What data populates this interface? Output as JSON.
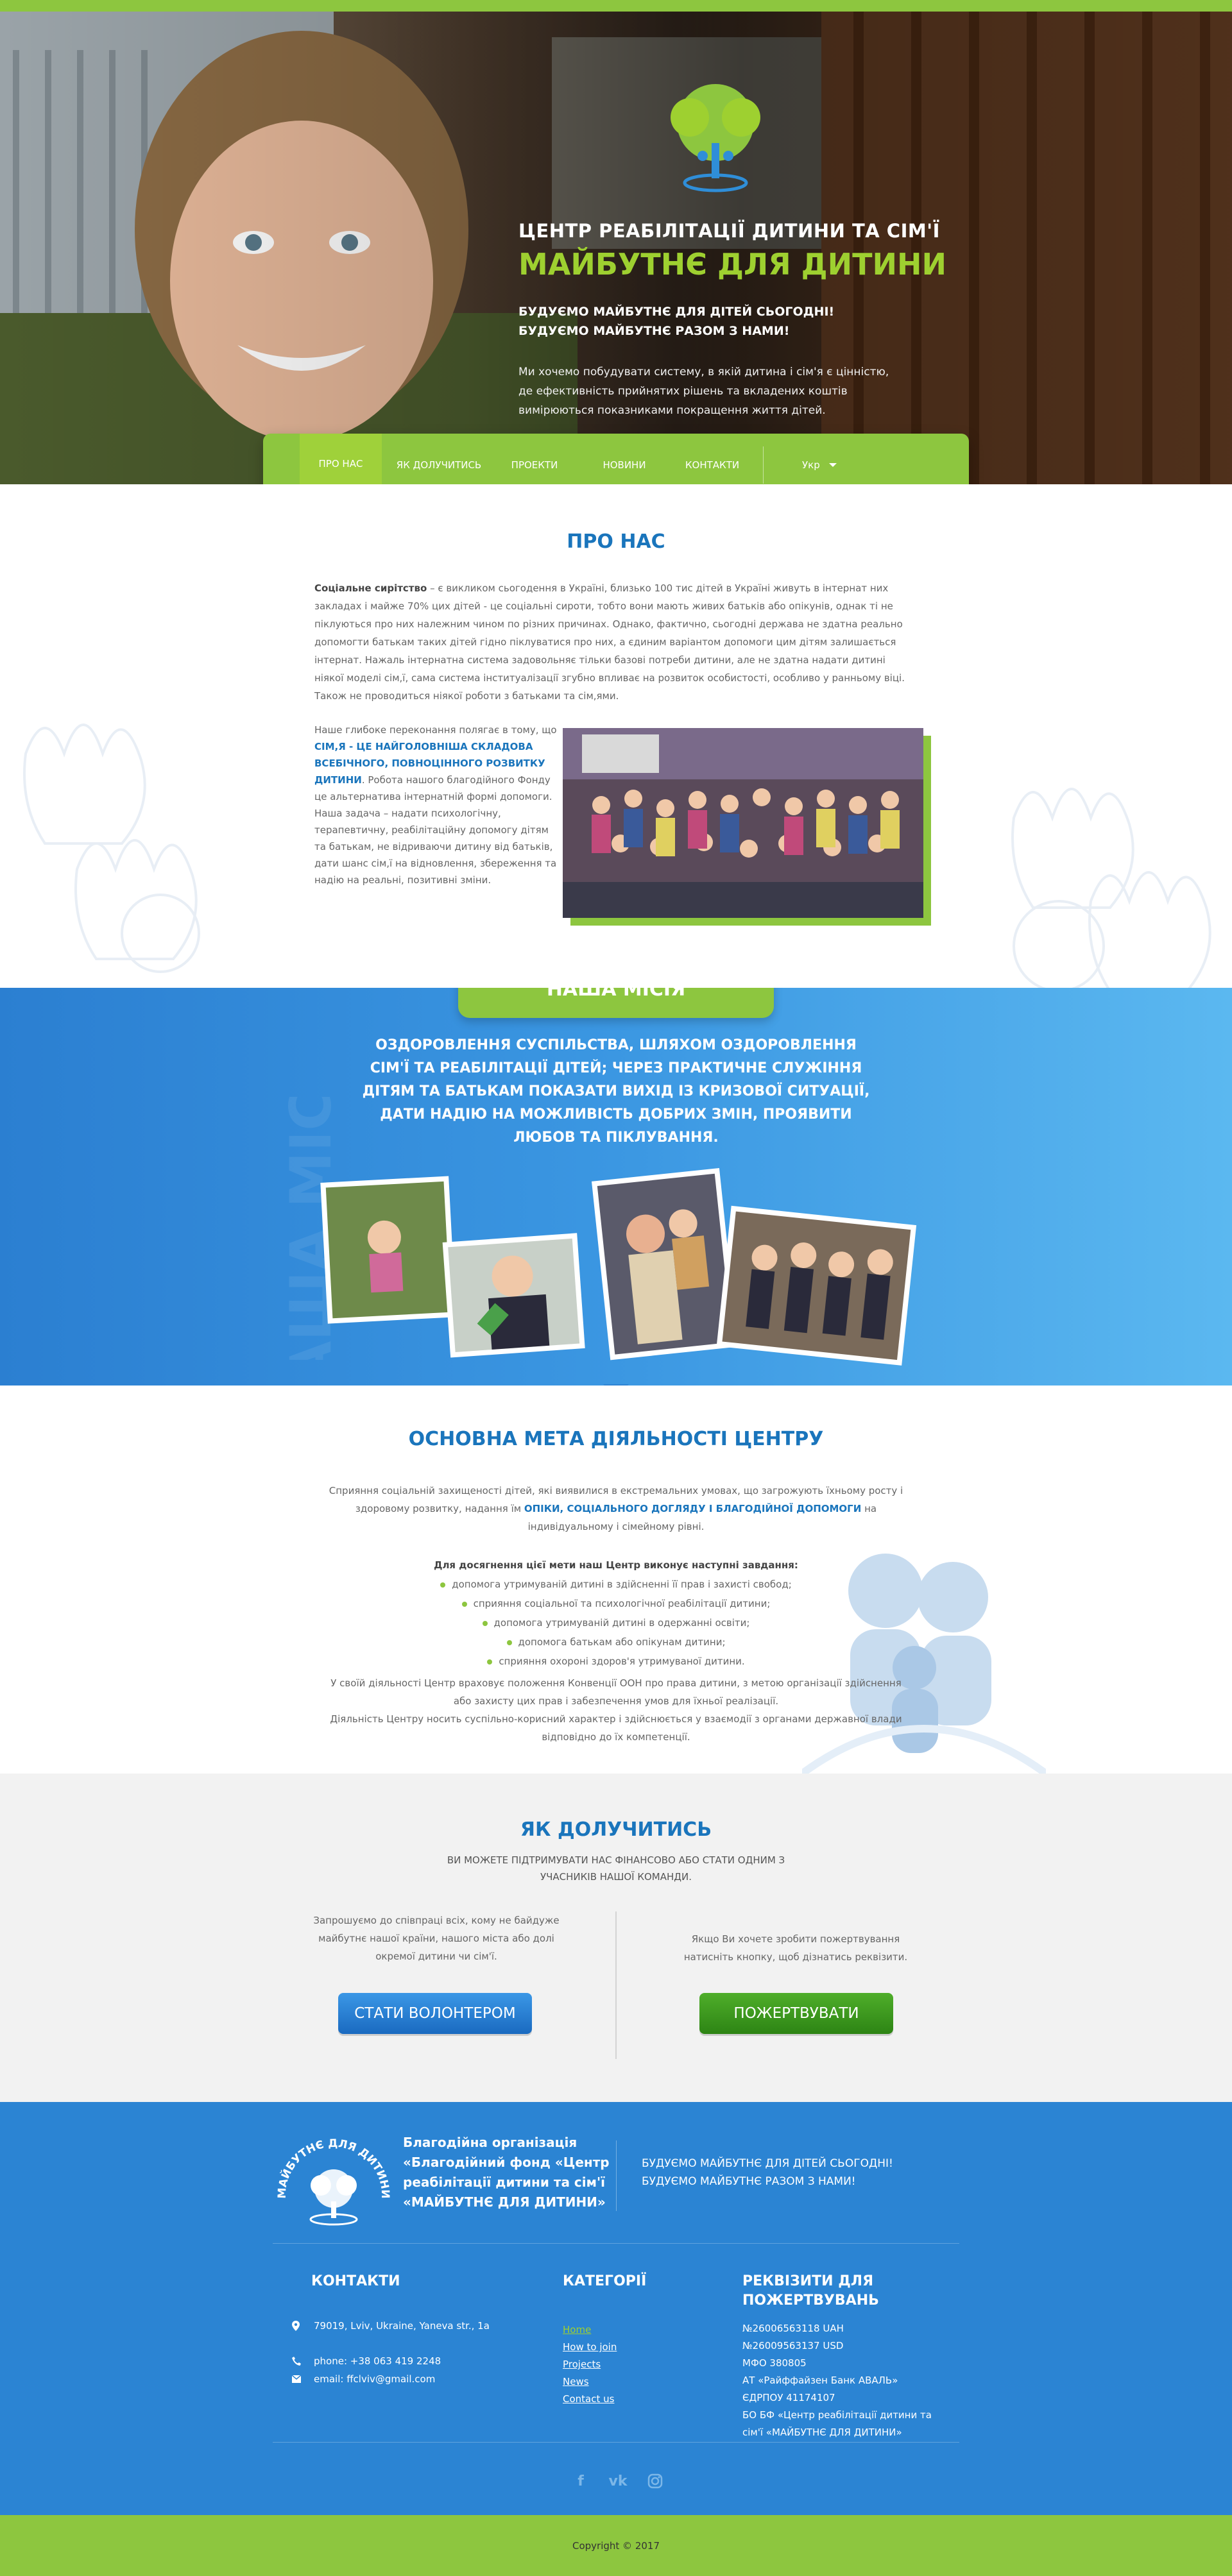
{
  "colors": {
    "brand_green": "#8dc63f",
    "brand_blue": "#1a75bc",
    "footer_blue": "#2b84d3",
    "title_green": "#9ed030"
  },
  "hero": {
    "pre_title": "ЦЕНТР РЕАБІЛІТАЦІЇ ДИТИНИ ТА СІМ'Ї",
    "title": "МАЙБУТНЄ ДЛЯ ДИТИНИ",
    "subtitle": "БУДУЄМО МАЙБУТНЄ ДЛЯ ДІТЕЙ СЬОГОДНІ! БУДУЄМО МАЙБУТНЄ РАЗОМ З НАМИ!",
    "description": "Ми хочемо побудувати систему, в якій дитина і сім'я є цінністю, де ефективність прийнятих рішень та вкладених коштів вимірюються показниками покращення життя дітей.",
    "logo_text": "МАЙБУТНЄ ДЛЯ ДИТИНИ"
  },
  "nav": {
    "items": [
      "ПРО НАС",
      "ЯК ДОЛУЧИТИСЬ",
      "ПРОЕКТИ",
      "НОВИНИ",
      "КОНТАКТИ"
    ],
    "active_index": 0,
    "language": "Укр"
  },
  "about": {
    "title": "ПРО НАС",
    "p1_lead": "Соціальне сирітство",
    "p1_text": " – є викликом сьогодення в Україні, близько 100 тис дітей в Україні живуть в інтернат них закладах і майже 70% цих дітей - це соціальні сироти, тобто вони мають живих батьків або опікунів, однак ті не піклуються про них належним чином по різних причинах. Однако, фактично, сьогодні держава не здатна реально допомогти батькам таких дітей гідно піклуватися про них, а єдиним варіантом допомоги цим дітям залишається інтернат. Нажаль інтернатна система задовольняє тільки базові потреби дитини, але не здатна надати дитині ніякої моделі сім,ї, сама система інституалізації згубно впливає на розвиток особистості, особливо у ранньому віці. Також не проводиться ніякої роботи з батьками та сім,ями.",
    "p2_a": "Наше глибоке переконання полягає в тому, що ",
    "p2_hl": "СІМ,Я - ЦЕ НАЙГОЛОВНІША СКЛАДОВА ВСЕБІЧНОГО, ПОВНОЦІННОГО РОЗВИТКУ ДИТИНИ",
    "p2_b": ".  Робота нашого благодійного Фонду це альтернатива інтернатній формі допомоги. Наша задача – надати психологічну, терапевтичну, реабілітаційну допомогу дітям та батькам, не відриваючи дитину від батьків, дати шанс сім,ї на відновлення, збереження та надію на реальні, позитивні зміни."
  },
  "mission": {
    "badge": "НАША МІСІЯ",
    "text": "ОЗДОРОВЛЕННЯ СУСПІЛЬСТВА, ШЛЯХОМ ОЗДОРОВЛЕННЯ СІМ'Ї ТА РЕАБІЛІТАЦІЇ ДІТЕЙ; ЧЕРЕЗ ПРАКТИЧНЕ СЛУЖІННЯ ДІТЯМ ТА  БАТЬКАМ  ПОКАЗАТИ ВИХІД ІЗ КРИЗОВОЇ СИТУАЦІЇ, ДАТИ НАДІЮ НА МОЖЛИВІСТЬ ДОБРИХ ЗМІН, ПРОЯВИТИ ЛЮБОВ ТА ПІКЛУВАННЯ.",
    "watermark": "НАША МІСІЯ"
  },
  "goal": {
    "title": "ОСНОВНА МЕТА ДІЯЛЬНОСТІ ЦЕНТРУ",
    "p1_a": "Сприяння соціальній захищеності дітей, які виявилися в екстремальних умовах, що загрожують їхньому росту і здоровому розвитку, надання їм ",
    "p1_hl": "ОПІКИ, СОЦІАЛЬНОГО ДОГЛЯДУ І БЛАГОДІЙНОЇ ДОПОМОГИ",
    "p1_b": " на індивідуальному і сімейному рівні.",
    "tasks_title": "Для досягнення цієї  мети наш Центр виконує наступні завдання:",
    "tasks": [
      "допомога утримуваній дитині в здійсненні її прав і захисті свобод;",
      "сприяння соціальної та психологічної реабілітації дитини;",
      "допомога утримуваній дитині в одержанні освіти;",
      "допомога батькам або опікунам дитини;",
      "сприяння охороні здоров'я утримуваної  дитини."
    ],
    "p2": "У своїй діяльності Центр враховує положення Конвенції ООН про права дитини, з метою організації здійснення або захисту цих прав і забезпечення умов для їхньої реалізації.",
    "p3": "Діяльність Центру носить суспільно-корисний характер і здійснюється у взаємодії з органами державної влади відповідно до їх компетенції."
  },
  "join": {
    "title": "ЯК ДОЛУЧИТИСЬ",
    "subtitle": "ВИ МОЖЕТЕ ПІДТРИМУВАТИ НАС ФІНАНСОВО АБО СТАТИ ОДНИМ З УЧАСНИКІВ НАШОЇ КОМАНДИ.",
    "left_text": "Запрошуємо до співпраці всіх, кому не байдуже майбутнє нашої країни, нашого міста або  долі окремої дитини чи сім'ї.",
    "right_text": "Якщо Ви хочете зробити пожертвування натисніть кнопку, щоб дізнатись реквізити.",
    "volunteer_button": "СТАТИ ВОЛОНТЕРОМ",
    "donate_button": "ПОЖЕРТВУВАТИ"
  },
  "footer": {
    "org": "Благодійна організація «Благодійний фонд «Центр реабілітації дитини та сім'ї «МАЙБУТНЄ ДЛЯ ДИТИНИ»",
    "slogan": "БУДУЄМО МАЙБУТНЄ ДЛЯ ДІТЕЙ СЬОГОДНІ! БУДУЄМО МАЙБУТНЄ РАЗОМ З НАМИ!",
    "contacts_title": "КОНТАКТИ",
    "address": "79019, Lviv, Ukraine, Yaneva str., 1a",
    "phone": "phone: +38 063 419 2248",
    "email": "email: ffclviv@gmail.com",
    "categories_title": "КАТЕГОРІЇ",
    "categories": [
      "Home",
      "How to join",
      "Projects",
      "News",
      "Contact us"
    ],
    "current_category": 0,
    "requisites_title": "РЕКВІЗИТИ ДЛЯ ПОЖЕРТВУВАНЬ",
    "requisites": [
      "№26006563118  UAH",
      "№26009563137 USD",
      "МФО 380805",
      "АТ «Райффайзен Банк АВАЛЬ»",
      "ЄДРПОУ 41174107",
      "БО БФ «Центр реабілітації дитини та сім'ї «МАЙБУТНЄ ДЛЯ ДИТИНИ»"
    ],
    "social": [
      "facebook-icon",
      "vk-icon",
      "instagram-icon"
    ]
  },
  "copyright": "Copyright © 2017"
}
